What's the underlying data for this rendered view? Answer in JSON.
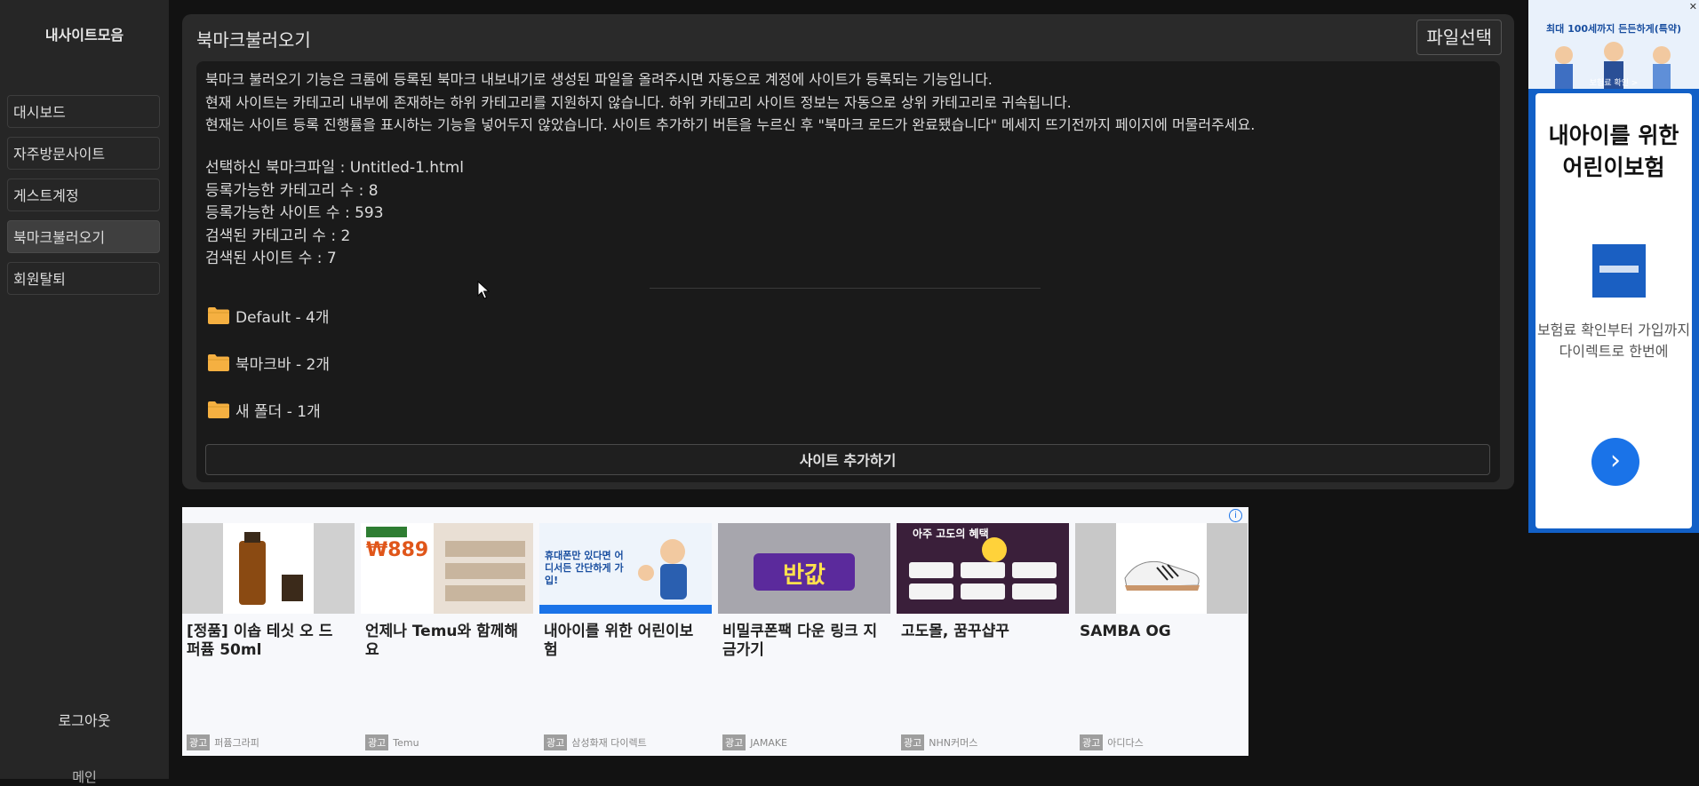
{
  "sidebar": {
    "brand": "내사이트모음",
    "items": [
      {
        "label": "대시보드",
        "active": false
      },
      {
        "label": "자주방문사이트",
        "active": false
      },
      {
        "label": "게스트계정",
        "active": false
      },
      {
        "label": "북마크불러오기",
        "active": true
      },
      {
        "label": "회원탈퇴",
        "active": false
      }
    ],
    "logout": "로그아웃",
    "main": "메인"
  },
  "panel": {
    "title": "북마크불러오기",
    "file_button": "파일선택",
    "description": [
      "북마크 불러오기 기능은 크롬에 등록된 북마크 내보내기로 생성된 파일을 올려주시면 자동으로 계정에 사이트가 등록되는 기능입니다.",
      "현재 사이트는 카테고리 내부에 존재하는 하위 카테고리를 지원하지 않습니다. 하위 카테고리 사이트 정보는 자동으로 상위 카테고리로 귀속됩니다.",
      "현재는 사이트 등록 진행률을 표시하는 기능을 넣어두지 않았습니다. 사이트 추가하기 버튼을 누르신 후 \"북마크 로드가 완료됐습니다\" 메세지 뜨기전까지 페이지에 머물러주세요."
    ],
    "stats": [
      "선택하신 북마크파일 : Untitled-1.html",
      "등록가능한 카테고리 수 : 8",
      "등록가능한 사이트 수 : 593",
      "검색된 카테고리 수 : 2",
      "검색된 사이트 수 : 7"
    ],
    "folders": [
      {
        "label": "Default - 4개"
      },
      {
        "label": "북마크바 - 2개"
      },
      {
        "label": "새 폴더 - 1개"
      }
    ],
    "add_button": "사이트 추가하기",
    "folder_color": "#f5b041"
  },
  "ad_bottom": {
    "info": "i",
    "badge": "광고",
    "cards": [
      {
        "title": "[정품] 이솝 테싯 오 드 퍼퓸 50ml",
        "advertiser": "퍼퓸그라피"
      },
      {
        "title": "언제나 Temu와 함께해요",
        "advertiser": "Temu",
        "image_text": "₩889"
      },
      {
        "title": "내아이를 위한 어린이보험",
        "advertiser": "삼성화재 다이렉트",
        "image_text": "휴대폰만 있다면 어디서든 간단하게 가입!"
      },
      {
        "title": "비밀쿠폰팩 다운 링크 지금가기",
        "advertiser": "JAMAKE",
        "image_text": "반값"
      },
      {
        "title": "고도몰, 꿈꾸샵꾸",
        "advertiser": "NHN커머스",
        "image_text": "아주 고도의 혜택"
      },
      {
        "title": "SAMBA OG",
        "advertiser": "아디다스"
      }
    ]
  },
  "ad_right": {
    "top_text_1": "최대 100세까지 든든하게(특약)",
    "top_text_2": "보험료 확인 >",
    "headline": "내아이를 위한 어린이보험",
    "sub": "보험료 확인부터 가입까지 다이렉트로 한번에",
    "go": "›",
    "close": "✕",
    "brand_color": "#1260c7"
  }
}
